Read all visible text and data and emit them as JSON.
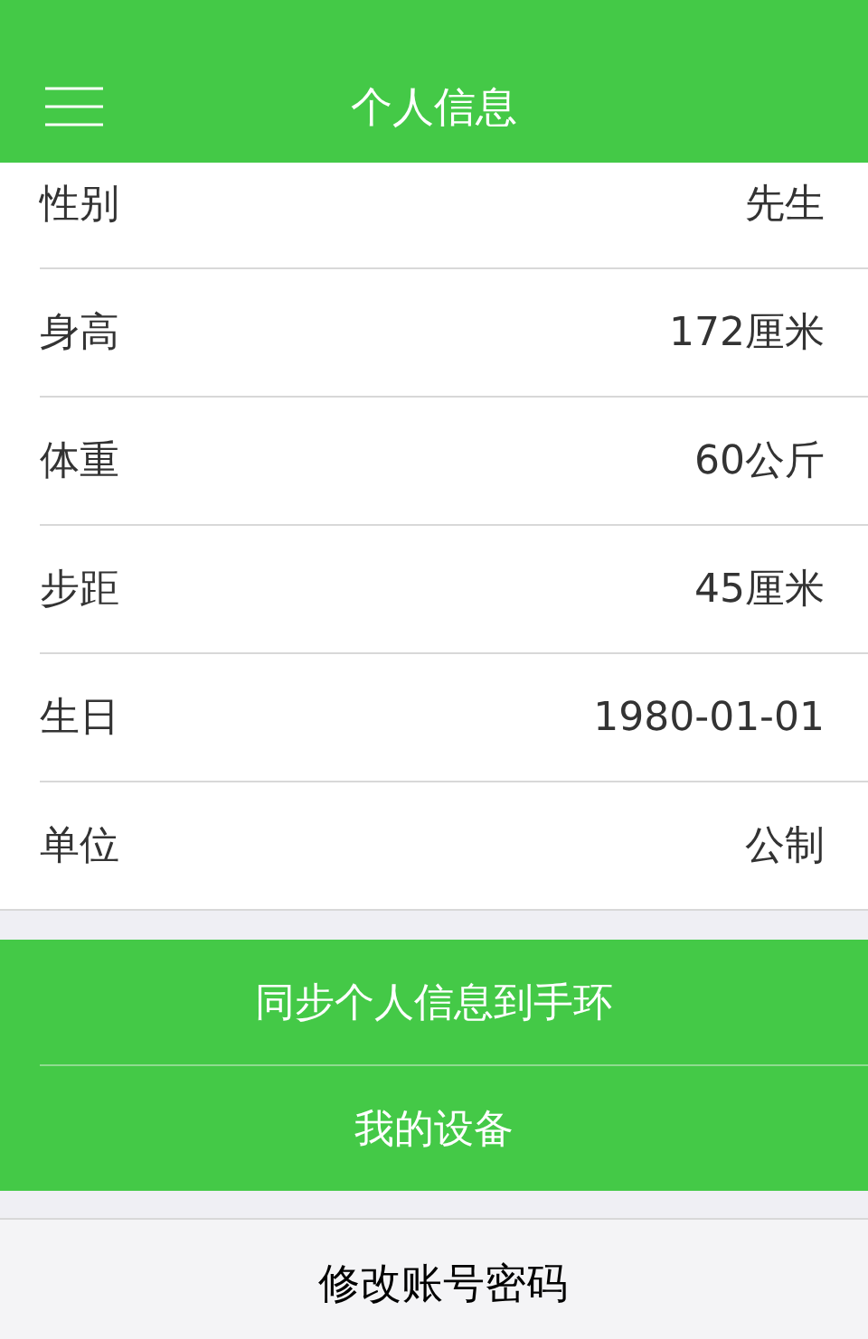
{
  "header": {
    "title": "个人信息"
  },
  "fields": [
    {
      "label": "性别",
      "value": "先生"
    },
    {
      "label": "身高",
      "value": "172厘米"
    },
    {
      "label": "体重",
      "value": "60公斤"
    },
    {
      "label": "步距",
      "value": "45厘米"
    },
    {
      "label": "生日",
      "value": "1980-01-01"
    },
    {
      "label": "单位",
      "value": "公制"
    }
  ],
  "actions": [
    "同步个人信息到手环",
    "我的设备"
  ],
  "account": {
    "label": "修改账号密码"
  }
}
